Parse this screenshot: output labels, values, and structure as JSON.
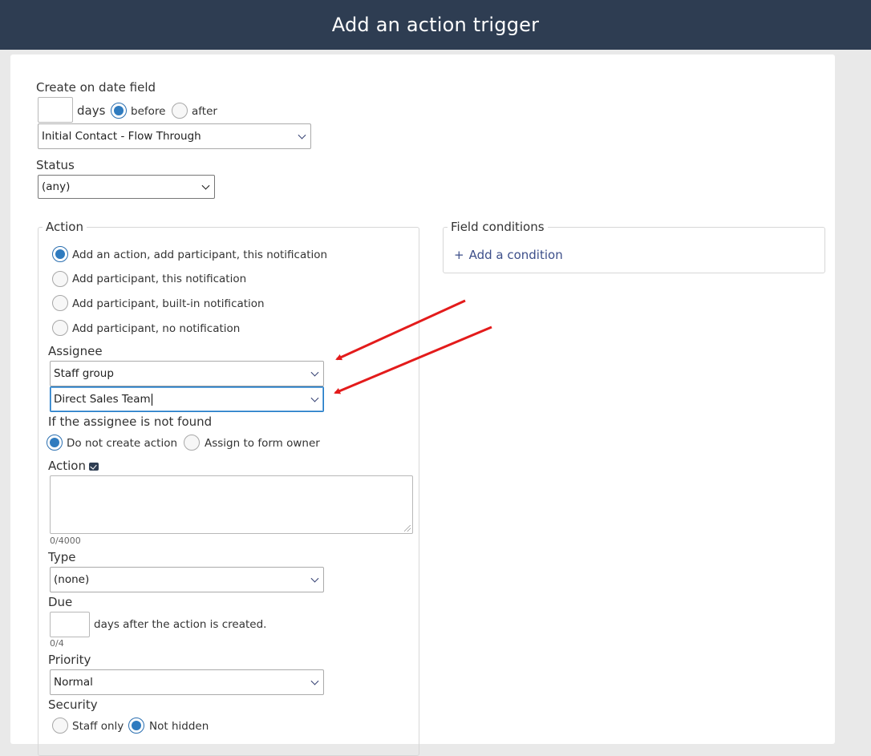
{
  "header": {
    "title": "Add an action trigger"
  },
  "create_on_date": {
    "label": "Create on date field",
    "days_value": "",
    "days_label": "days",
    "before_label": "before",
    "after_label": "after",
    "before_selected": true,
    "date_field_selected": "Initial Contact - Flow Through"
  },
  "status": {
    "label": "Status",
    "selected": "(any)"
  },
  "action_panel": {
    "legend": "Action",
    "options": [
      {
        "label": "Add an action, add participant, this notification",
        "selected": true
      },
      {
        "label": "Add participant, this notification",
        "selected": false
      },
      {
        "label": "Add participant, built-in notification",
        "selected": false
      },
      {
        "label": "Add participant, no notification",
        "selected": false
      }
    ],
    "assignee": {
      "label": "Assignee",
      "type_selected": "Staff group",
      "group_selected": "Direct Sales Team"
    },
    "not_found": {
      "label": "If the assignee is not found",
      "do_not_create_label": "Do not create action",
      "assign_owner_label": "Assign to form owner"
    },
    "action_text": {
      "label": "Action",
      "value": "",
      "counter": "0/4000"
    },
    "type": {
      "label": "Type",
      "selected": "(none)"
    },
    "due": {
      "label": "Due",
      "days_value": "",
      "suffix": "days after the action is created.",
      "counter": "0/4"
    },
    "priority": {
      "label": "Priority",
      "selected": "Normal"
    },
    "security": {
      "label": "Security",
      "staff_only_label": "Staff only",
      "not_hidden_label": "Not hidden"
    }
  },
  "field_conditions": {
    "legend": "Field conditions",
    "add_label": "Add a condition",
    "plus": "+"
  },
  "colors": {
    "header_bg": "#2e3d52",
    "radio_selected": "#2f7bbf",
    "link": "#3d4f8a",
    "annotation_arrow": "#e31b1b"
  }
}
